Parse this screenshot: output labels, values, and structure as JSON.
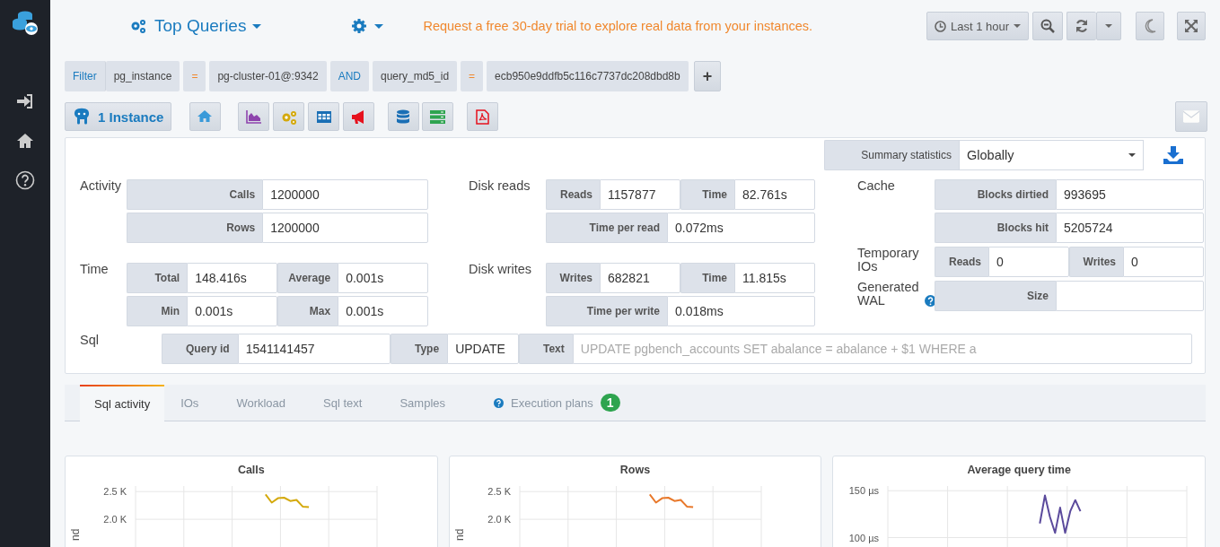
{
  "header": {
    "title": "Top Queries",
    "notice": "Request a free 30-day trial to explore real data from your instances.",
    "time_range": "Last 1 hour"
  },
  "filter": {
    "label": "Filter",
    "terms": [
      {
        "kind": "field",
        "text": "pg_instance"
      },
      {
        "kind": "operator",
        "text": "="
      },
      {
        "kind": "value",
        "text": "pg-cluster-01@:9342"
      },
      {
        "kind": "conjunction",
        "text": "AND"
      },
      {
        "kind": "field",
        "text": "query_md5_id"
      },
      {
        "kind": "operator",
        "text": "="
      },
      {
        "kind": "value",
        "text": "ecb950e9ddfb5c116c7737dc208dbd8b"
      }
    ],
    "add": "+"
  },
  "toolbar": {
    "instances": "1 Instance"
  },
  "summary": {
    "label": "Summary statistics",
    "value": "Globally"
  },
  "columns": [
    {
      "groups": [
        {
          "title": "Activity",
          "help": false,
          "rows": [
            [
              {
                "label": "Calls",
                "value": "1200000"
              }
            ],
            [
              {
                "label": "Rows",
                "value": "1200000"
              }
            ]
          ]
        },
        {
          "title": "Time",
          "help": false,
          "rows": [
            [
              {
                "label": "Total",
                "value": "148.416s"
              },
              {
                "label": "Average",
                "value": "0.001s"
              }
            ],
            [
              {
                "label": "Min",
                "value": "0.001s"
              },
              {
                "label": "Max",
                "value": "0.001s"
              }
            ]
          ]
        }
      ]
    },
    {
      "groups": [
        {
          "title": "Disk reads",
          "help": false,
          "rows": [
            [
              {
                "label": "Reads",
                "value": "1157877"
              },
              {
                "label": "Time",
                "value": "82.761s"
              }
            ],
            [
              {
                "label": "Time per read",
                "value": "0.072ms"
              }
            ]
          ]
        },
        {
          "title": "Disk writes",
          "help": false,
          "rows": [
            [
              {
                "label": "Writes",
                "value": "682821"
              },
              {
                "label": "Time",
                "value": "11.815s"
              }
            ],
            [
              {
                "label": "Time per write",
                "value": "0.018ms"
              }
            ]
          ]
        }
      ]
    },
    {
      "groups": [
        {
          "title": "Cache",
          "help": false,
          "rows": [
            [
              {
                "label": "Blocks dirtied",
                "value": "993695"
              }
            ],
            [
              {
                "label": "Blocks hit",
                "value": "5205724"
              }
            ]
          ]
        },
        {
          "title": "Temporary IOs",
          "help": false,
          "rows": [
            [
              {
                "label": "Reads",
                "value": "0"
              },
              {
                "label": "Writes",
                "value": "0"
              }
            ]
          ]
        },
        {
          "title": "Generated WAL",
          "help": true,
          "rows": [
            [
              {
                "label": "Size"
              }
            ]
          ]
        }
      ]
    }
  ],
  "sql": {
    "title": "Sql",
    "fields": [
      {
        "label": "Query id",
        "value": "1541141457",
        "disabled": false
      },
      {
        "label": "Type",
        "value": "UPDATE",
        "disabled": false
      },
      {
        "label": "Text",
        "value": "UPDATE pgbench_accounts SET abalance = abalance + $1 WHERE a",
        "disabled": true
      }
    ]
  },
  "tabs": [
    {
      "label": "Sql activity",
      "selected": true,
      "help": false
    },
    {
      "label": "IOs",
      "selected": false,
      "help": false
    },
    {
      "label": "Workload",
      "selected": false,
      "help": false
    },
    {
      "label": "Sql text",
      "selected": false,
      "help": false
    },
    {
      "label": "Samples",
      "selected": false,
      "help": false
    },
    {
      "label": "Execution plans",
      "selected": false,
      "help": true,
      "badge": "1"
    }
  ],
  "charts": [
    {
      "chart_data": {
        "type": "line",
        "title": "Calls",
        "ylabel": "nd",
        "grid": true,
        "ylim": [
          1500,
          2600
        ],
        "yticks": [
          {
            "value": 2500,
            "label": "2.5 K"
          },
          {
            "value": 2000,
            "label": "2.0 K"
          }
        ],
        "series": [
          {
            "color": "#d4a90c",
            "values": [
              null,
              null,
              null,
              null,
              null,
              null,
              null,
              null,
              null,
              null,
              null,
              null,
              null,
              null,
              null,
              null,
              null,
              null,
              null,
              null,
              null,
              2450,
              2300,
              2380,
              2390,
              2330,
              2350,
              2230,
              2220,
              null,
              null,
              null,
              null,
              null,
              null,
              null,
              null,
              null,
              null,
              null
            ]
          }
        ]
      }
    },
    {
      "chart_data": {
        "type": "line",
        "title": "Rows",
        "ylabel": "nd",
        "grid": true,
        "ylim": [
          1500,
          2600
        ],
        "yticks": [
          {
            "value": 2500,
            "label": "2.5 K"
          },
          {
            "value": 2000,
            "label": "2.0 K"
          }
        ],
        "series": [
          {
            "color": "#e8782a",
            "values": [
              null,
              null,
              null,
              null,
              null,
              null,
              null,
              null,
              null,
              null,
              null,
              null,
              null,
              null,
              null,
              null,
              null,
              null,
              null,
              null,
              null,
              2450,
              2300,
              2380,
              2390,
              2330,
              2350,
              2230,
              2220,
              null,
              null,
              null,
              null,
              null,
              null,
              null,
              null,
              null,
              null,
              null
            ]
          }
        ]
      }
    },
    {
      "chart_data": {
        "type": "line",
        "title": "Average query time",
        "grid": true,
        "ylim": [
          90,
          155
        ],
        "yticks": [
          {
            "value": 150,
            "label": "150 µs"
          },
          {
            "value": 100,
            "label": "100 µs"
          }
        ],
        "series": [
          {
            "color": "#5b4a9c",
            "values": [
              null,
              null,
              null,
              null,
              null,
              null,
              null,
              null,
              null,
              null,
              null,
              null,
              null,
              null,
              null,
              null,
              null,
              null,
              null,
              null,
              null,
              null,
              null,
              null,
              null,
              null,
              null,
              null,
              null,
              null,
              115,
              145,
              122,
              105,
              132,
              105,
              128,
              140,
              128,
              null,
              null,
              null,
              null,
              null,
              null,
              null,
              null,
              null,
              null,
              null,
              null,
              null,
              null,
              null,
              null,
              null,
              null,
              null,
              null,
              null
            ]
          }
        ]
      }
    }
  ]
}
